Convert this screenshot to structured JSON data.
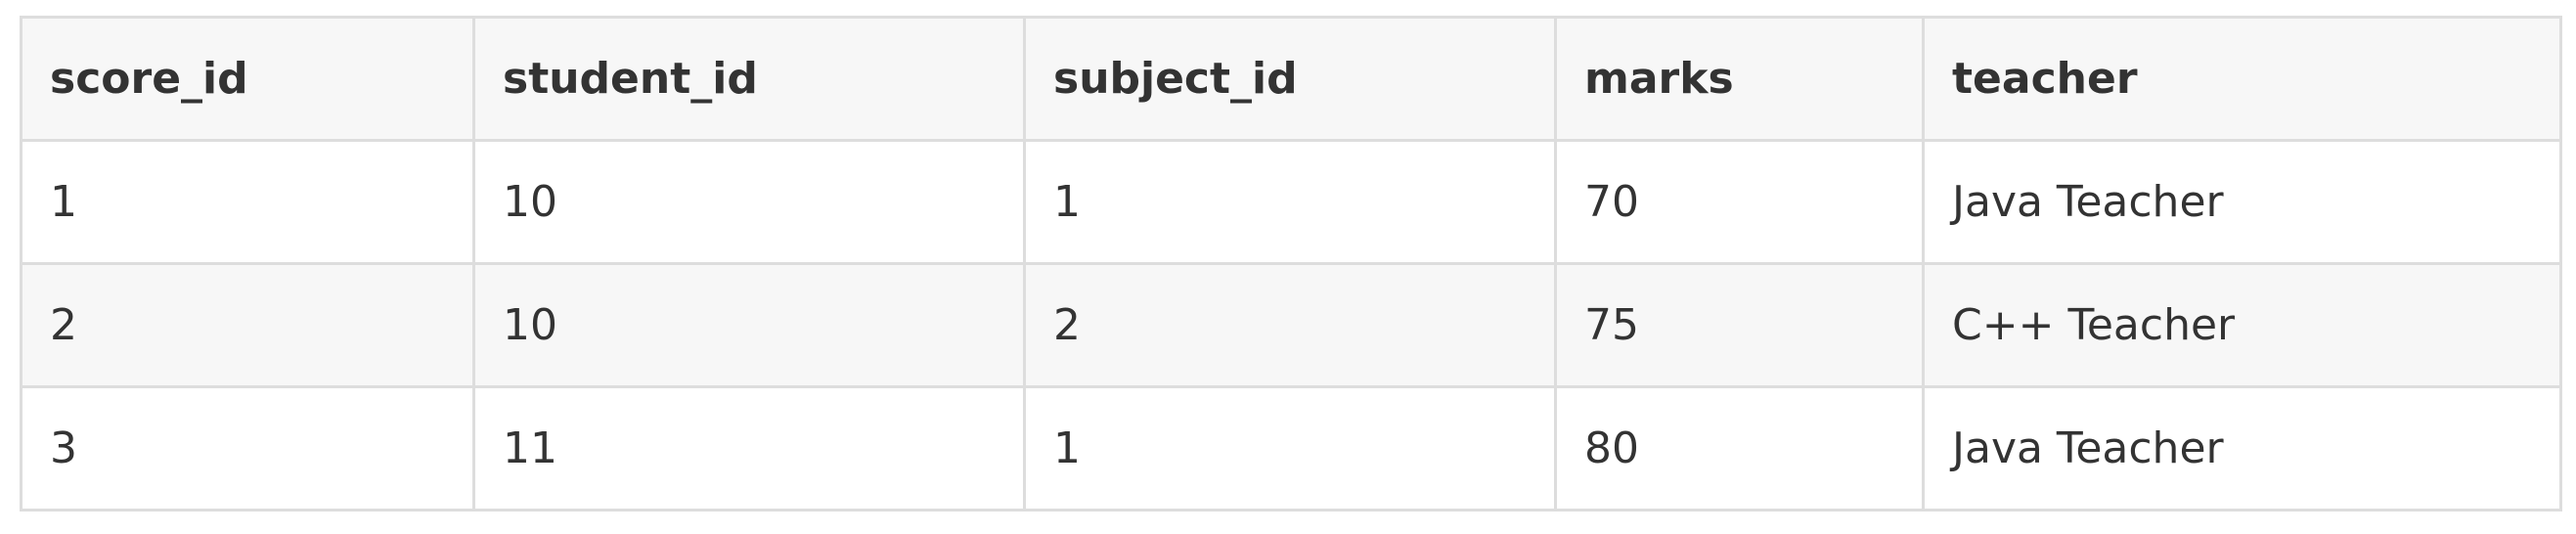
{
  "table": {
    "headers": [
      "score_id",
      "student_id",
      "subject_id",
      "marks",
      "teacher"
    ],
    "rows": [
      [
        "1",
        "10",
        "1",
        "70",
        "Java Teacher"
      ],
      [
        "2",
        "10",
        "2",
        "75",
        "C++ Teacher"
      ],
      [
        "3",
        "11",
        "1",
        "80",
        "Java Teacher"
      ]
    ]
  },
  "colors": {
    "border": "#dddddd",
    "header_bg": "#f7f7f7",
    "stripe_bg": "#f7f7f7",
    "row_bg": "#ffffff",
    "text": "#333333"
  }
}
